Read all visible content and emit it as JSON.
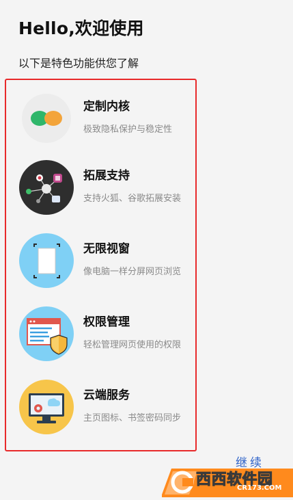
{
  "header": {
    "title": "Hello,欢迎使用",
    "subtitle": "以下是特色功能供您了解"
  },
  "features": [
    {
      "title": "定制内核",
      "desc": "极致隐私保护与稳定性",
      "icon": "custom-kernel-icon"
    },
    {
      "title": "拓展支持",
      "desc": "支持火狐、谷歌拓展安装",
      "icon": "extension-network-icon"
    },
    {
      "title": "无限视窗",
      "desc": "像电脑一样分屏网页浏览",
      "icon": "multi-window-icon"
    },
    {
      "title": "权限管理",
      "desc": "轻松管理网页使用的权限",
      "icon": "permission-shield-icon"
    },
    {
      "title": "云端服务",
      "desc": "主页图标、书签密码同步",
      "icon": "cloud-monitor-icon"
    }
  ],
  "continue_label": "继续",
  "watermark": {
    "brand": "西西软件园",
    "url": "CR173.COM"
  },
  "colors": {
    "highlight_border": "#e8292a",
    "continue_link": "#2f63c9",
    "desc_text": "#8a8a8a"
  }
}
